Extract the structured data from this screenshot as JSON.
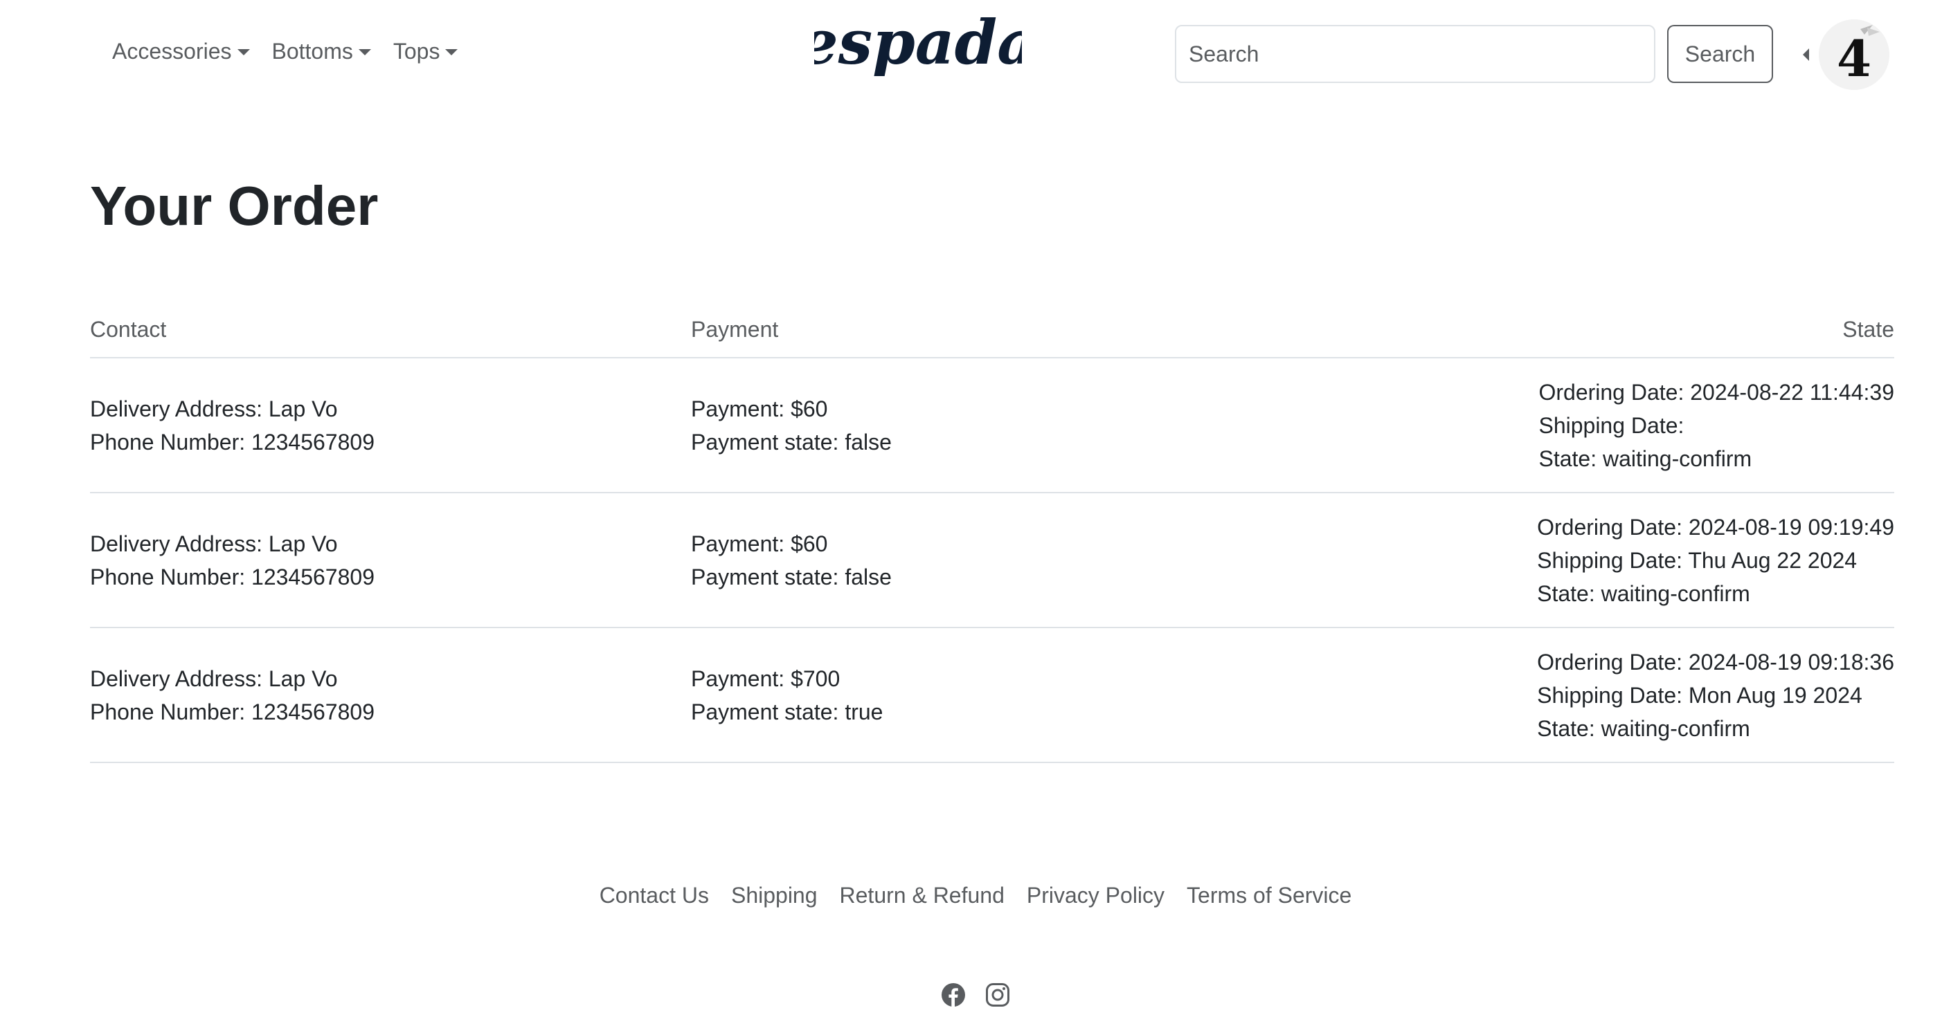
{
  "nav": {
    "menus": [
      {
        "label": "Accessories"
      },
      {
        "label": "Bottoms"
      },
      {
        "label": "Tops"
      }
    ],
    "brand": "espada",
    "search_placeholder": "Search",
    "search_button": "Search",
    "avatar_glyph": "4"
  },
  "main": {
    "title": "Your Order",
    "columns": {
      "contact": "Contact",
      "payment": "Payment",
      "state": "State"
    },
    "orders": [
      {
        "address": "Delivery Address: Lap Vo",
        "phone": "Phone Number: 1234567809",
        "payment": "Payment: $60",
        "payment_state": "Payment state: false",
        "ordering_date": "Ordering Date: 2024-08-22 11:44:39",
        "shipping_date": "Shipping Date:",
        "state": "State: waiting-confirm"
      },
      {
        "address": "Delivery Address: Lap Vo",
        "phone": "Phone Number: 1234567809",
        "payment": "Payment: $60",
        "payment_state": "Payment state: false",
        "ordering_date": "Ordering Date: 2024-08-19 09:19:49",
        "shipping_date": "Shipping Date: Thu Aug 22 2024",
        "state": "State: waiting-confirm"
      },
      {
        "address": "Delivery Address: Lap Vo",
        "phone": "Phone Number: 1234567809",
        "payment": "Payment: $700",
        "payment_state": "Payment state: true",
        "ordering_date": "Ordering Date: 2024-08-19 09:18:36",
        "shipping_date": "Shipping Date: Mon Aug 19 2024",
        "state": "State: waiting-confirm"
      }
    ]
  },
  "footer": {
    "links": [
      {
        "label": "Contact Us"
      },
      {
        "label": "Shipping"
      },
      {
        "label": "Return & Refund"
      },
      {
        "label": "Privacy Policy"
      },
      {
        "label": "Terms of Service"
      }
    ],
    "social": [
      {
        "icon": "facebook-icon"
      },
      {
        "icon": "instagram-icon"
      }
    ]
  },
  "colors": {
    "text": "#212529",
    "muted": "#595c5f",
    "border": "#dee2e6",
    "brand": "#0e1d33"
  }
}
